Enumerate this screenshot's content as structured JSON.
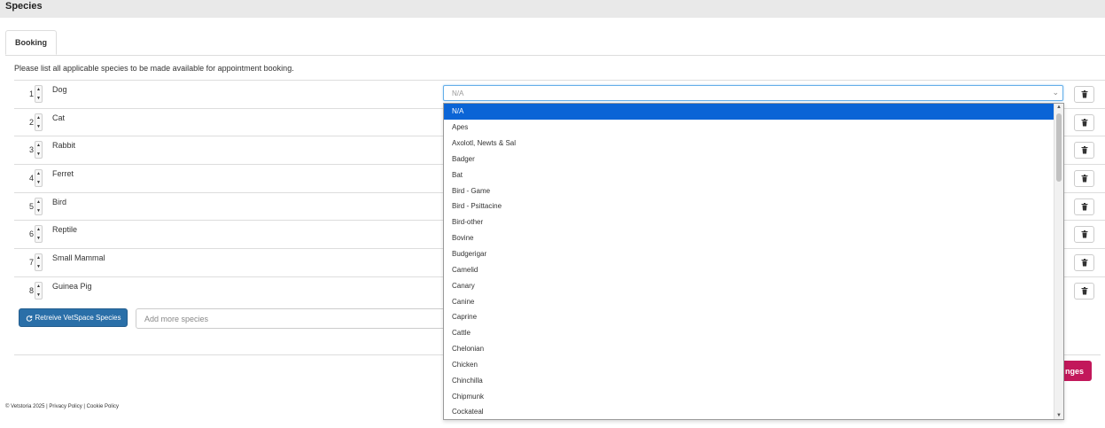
{
  "header": {
    "title": "Species"
  },
  "tabs": [
    {
      "label": "Booking"
    }
  ],
  "description": "Please list all applicable species to be made available for appointment booking.",
  "species_rows": [
    {
      "num": "1",
      "name": "Dog"
    },
    {
      "num": "2",
      "name": "Cat"
    },
    {
      "num": "3",
      "name": "Rabbit"
    },
    {
      "num": "4",
      "name": "Ferret"
    },
    {
      "num": "5",
      "name": "Bird"
    },
    {
      "num": "6",
      "name": "Reptile"
    },
    {
      "num": "7",
      "name": "Small Mammal"
    },
    {
      "num": "8",
      "name": "Guinea Pig"
    }
  ],
  "icons": {
    "spinner": "up-down-arrows-icon",
    "delete": "trash-icon",
    "refresh": "refresh-icon",
    "select": "chevron-down-icon"
  },
  "select": {
    "value": "N/A",
    "options": [
      "N/A",
      "Apes",
      "Axolotl, Newts & Sal",
      "Badger",
      "Bat",
      "Bird - Game",
      "Bird - Psittacine",
      "Bird-other",
      "Bovine",
      "Budgerigar",
      "Camelid",
      "Canary",
      "Canine",
      "Caprine",
      "Cattle",
      "Chelonian",
      "Chicken",
      "Chinchilla",
      "Chipmunk",
      "Cockateal"
    ],
    "selected_index": 0
  },
  "actions": {
    "retrieve_label": "Retreive VetSpace Species",
    "add_placeholder": "Add more species",
    "save_label_visible": "nges"
  },
  "footer": {
    "copyright": "© Vetstoria 2025",
    "separator": "|",
    "privacy": "Privacy Policy",
    "cookie": "Cookie Policy"
  },
  "colors": {
    "accent": "#2a6fa8",
    "save": "#c2185b",
    "option_selected": "#0a64d6"
  }
}
